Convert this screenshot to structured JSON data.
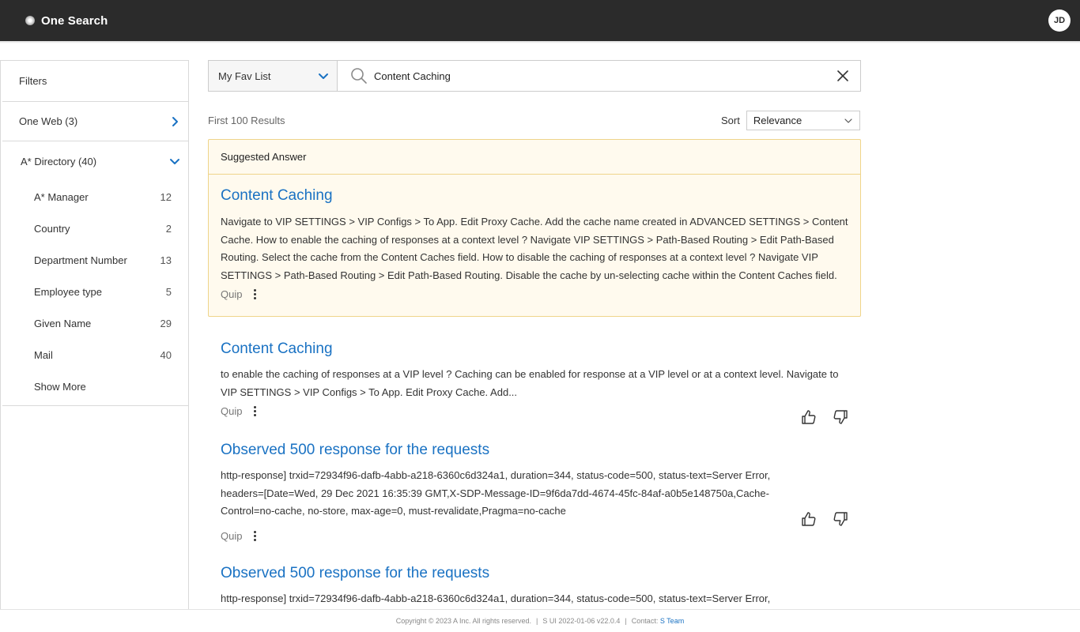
{
  "header": {
    "title": "One Search",
    "avatar_initials": "JD"
  },
  "sidebar": {
    "filters_label": "Filters",
    "sections": [
      {
        "label": "One Web (3)",
        "expanded": false
      },
      {
        "label": "A* Directory (40)",
        "expanded": true
      }
    ],
    "facets": [
      {
        "label": "A* Manager",
        "count": "12"
      },
      {
        "label": "Country",
        "count": "2"
      },
      {
        "label": "Department Number",
        "count": "13"
      },
      {
        "label": "Employee type",
        "count": "5"
      },
      {
        "label": "Given Name",
        "count": "29"
      },
      {
        "label": "Mail",
        "count": "40"
      }
    ],
    "show_more": "Show More"
  },
  "search": {
    "scope": "My Fav List",
    "query": "Content Caching"
  },
  "results_header": {
    "count_text": "First 100 Results",
    "sort_label": "Sort",
    "sort_value": "Relevance"
  },
  "suggested": {
    "heading": "Suggested Answer",
    "title": "Content Caching",
    "snippet": "Navigate to VIP SETTINGS > VIP Configs > To App. Edit Proxy Cache. Add the cache name created in ADVANCED SETTINGS > Content Cache. How to enable the caching of responses at a context level ? Navigate VIP SETTINGS > Path-Based Routing > Edit Path-Based Routing. Select the cache from the Content Caches field. How to disable the caching of responses at a context level ? Navigate VIP SETTINGS > Path-Based Routing > Edit Path-Based Routing. Disable the cache by un-selecting cache within the Content Caches field.",
    "source": "Quip"
  },
  "results": [
    {
      "title": "Content Caching",
      "snippet": "to enable the caching of responses at a VIP level ? Caching can be enabled for response at a VIP level or at a context level. Navigate to VIP SETTINGS > VIP Configs > To App. Edit Proxy Cache. Add...",
      "source": "Quip"
    },
    {
      "title": "Observed 500 response for the requests",
      "snippet": "http-response] trxid=72934f96-dafb-4abb-a218-6360c6d324a1, duration=344, status-code=500, status-text=Server Error, headers=[Date=Wed, 29 Dec 2021 16:35:39 GMT,X-SDP-Message-ID=9f6da7dd-4674-45fc-84af-a0b5e148750a,Cache-Control=no-cache, no-store, max-age=0, must-revalidate,Pragma=no-cache",
      "source": "Quip"
    },
    {
      "title": "Observed 500 response for the requests",
      "snippet": "http-response] trxid=72934f96-dafb-4abb-a218-6360c6d324a1, duration=344, status-code=500, status-text=Server Error,"
    }
  ],
  "footer": {
    "copyright": "Copyright © 2023 A Inc. All rights reserved.",
    "version": "S UI 2022-01-06 v22.0.4",
    "contact_label": "Contact:",
    "contact_link": "S Team"
  },
  "colors": {
    "header_bg": "#2b2b2b",
    "link": "#1a72c3",
    "suggested_bg": "#fffaee",
    "suggested_border": "#efd48a"
  }
}
